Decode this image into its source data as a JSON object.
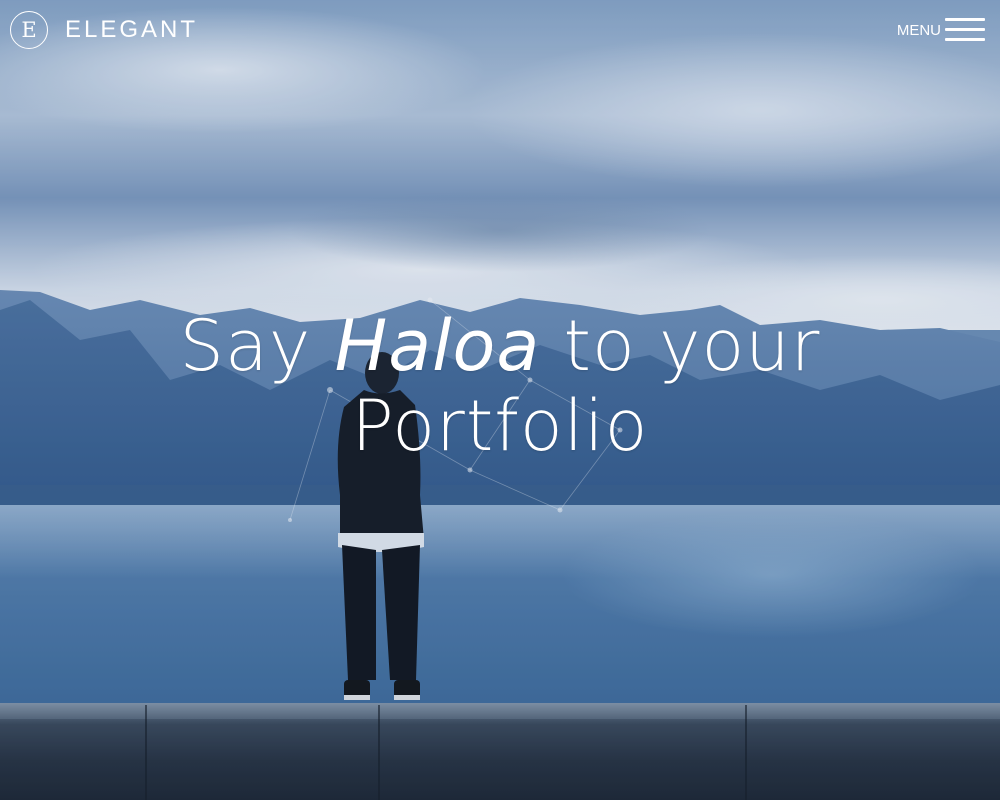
{
  "header": {
    "brand_mark": "E",
    "brand_name": "ELEGANT",
    "menu_label": "MENU"
  },
  "hero": {
    "headline_part1": "Say ",
    "headline_emphasis": "Haloa",
    "headline_part2": " to your",
    "headline_line2": "Portfolio"
  },
  "colors": {
    "text": "#ffffff",
    "sky": "#b9c9dc",
    "lake": "#4f79a6",
    "mountains": "#3d6494",
    "wall": "#262f3b"
  },
  "icons": {
    "menu": "hamburger-icon"
  }
}
